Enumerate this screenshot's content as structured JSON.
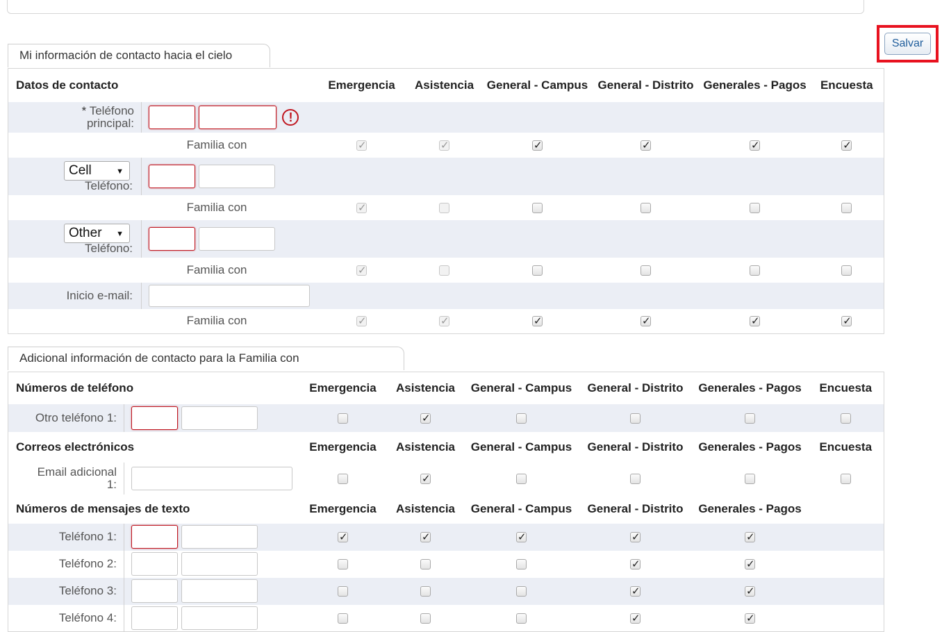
{
  "actions": {
    "save_label": "Salvar"
  },
  "section1": {
    "tab_title": "Mi información de contacto hacia el cielo",
    "header_left": "Datos de contacto",
    "columns": [
      "Emergencia",
      "Asistencia",
      "General - Campus",
      "General - Distrito",
      "Generales - Pagos",
      "Encuesta"
    ],
    "primary_phone_label": "Teléfono principal:",
    "required_mark": "*",
    "error_icon": "!",
    "family_label": "Familia con",
    "phone2_type": "Cell",
    "phone3_type": "Other",
    "phone_label": "Teléfono:",
    "email_label": "Inicio e-mail:",
    "email_value": "",
    "checks": {
      "primary": [
        true,
        true,
        true,
        true,
        true,
        true
      ],
      "cell": [
        true,
        false,
        false,
        false,
        false,
        false
      ],
      "other": [
        true,
        false,
        false,
        false,
        false,
        false
      ],
      "email": [
        true,
        true,
        true,
        true,
        true,
        true
      ]
    },
    "disabled": {
      "primary": [
        true,
        true,
        false,
        false,
        false,
        false
      ],
      "cell": [
        true,
        true,
        false,
        false,
        false,
        false
      ],
      "other": [
        true,
        true,
        false,
        false,
        false,
        false
      ],
      "email": [
        true,
        true,
        false,
        false,
        false,
        false
      ]
    }
  },
  "section2": {
    "tab_title": "Adicional información de contacto para la Familia con",
    "phones_header": "Números de teléfono",
    "emails_header": "Correos electrónicos",
    "texts_header": "Números de mensajes de texto",
    "columns": [
      "Emergencia",
      "Asistencia",
      "General - Campus",
      "General - Distrito",
      "Generales - Pagos",
      "Encuesta"
    ],
    "text_columns": [
      "Emergencia",
      "Asistencia",
      "General - Campus",
      "General - Distrito",
      "Generales - Pagos"
    ],
    "other_phone_label": "Otro teléfono 1:",
    "other_phone_checks": [
      false,
      true,
      false,
      false,
      false,
      false
    ],
    "email_label": "Email adicional 1:",
    "email_checks": [
      false,
      true,
      false,
      false,
      false,
      false
    ],
    "text_rows": [
      {
        "label": "Teléfono 1:",
        "checks": [
          true,
          true,
          true,
          true,
          true
        ]
      },
      {
        "label": "Teléfono 2:",
        "checks": [
          false,
          false,
          false,
          true,
          true
        ]
      },
      {
        "label": "Teléfono 3:",
        "checks": [
          false,
          false,
          false,
          true,
          true
        ]
      },
      {
        "label": "Teléfono 4:",
        "checks": [
          false,
          false,
          false,
          true,
          true
        ]
      }
    ]
  }
}
